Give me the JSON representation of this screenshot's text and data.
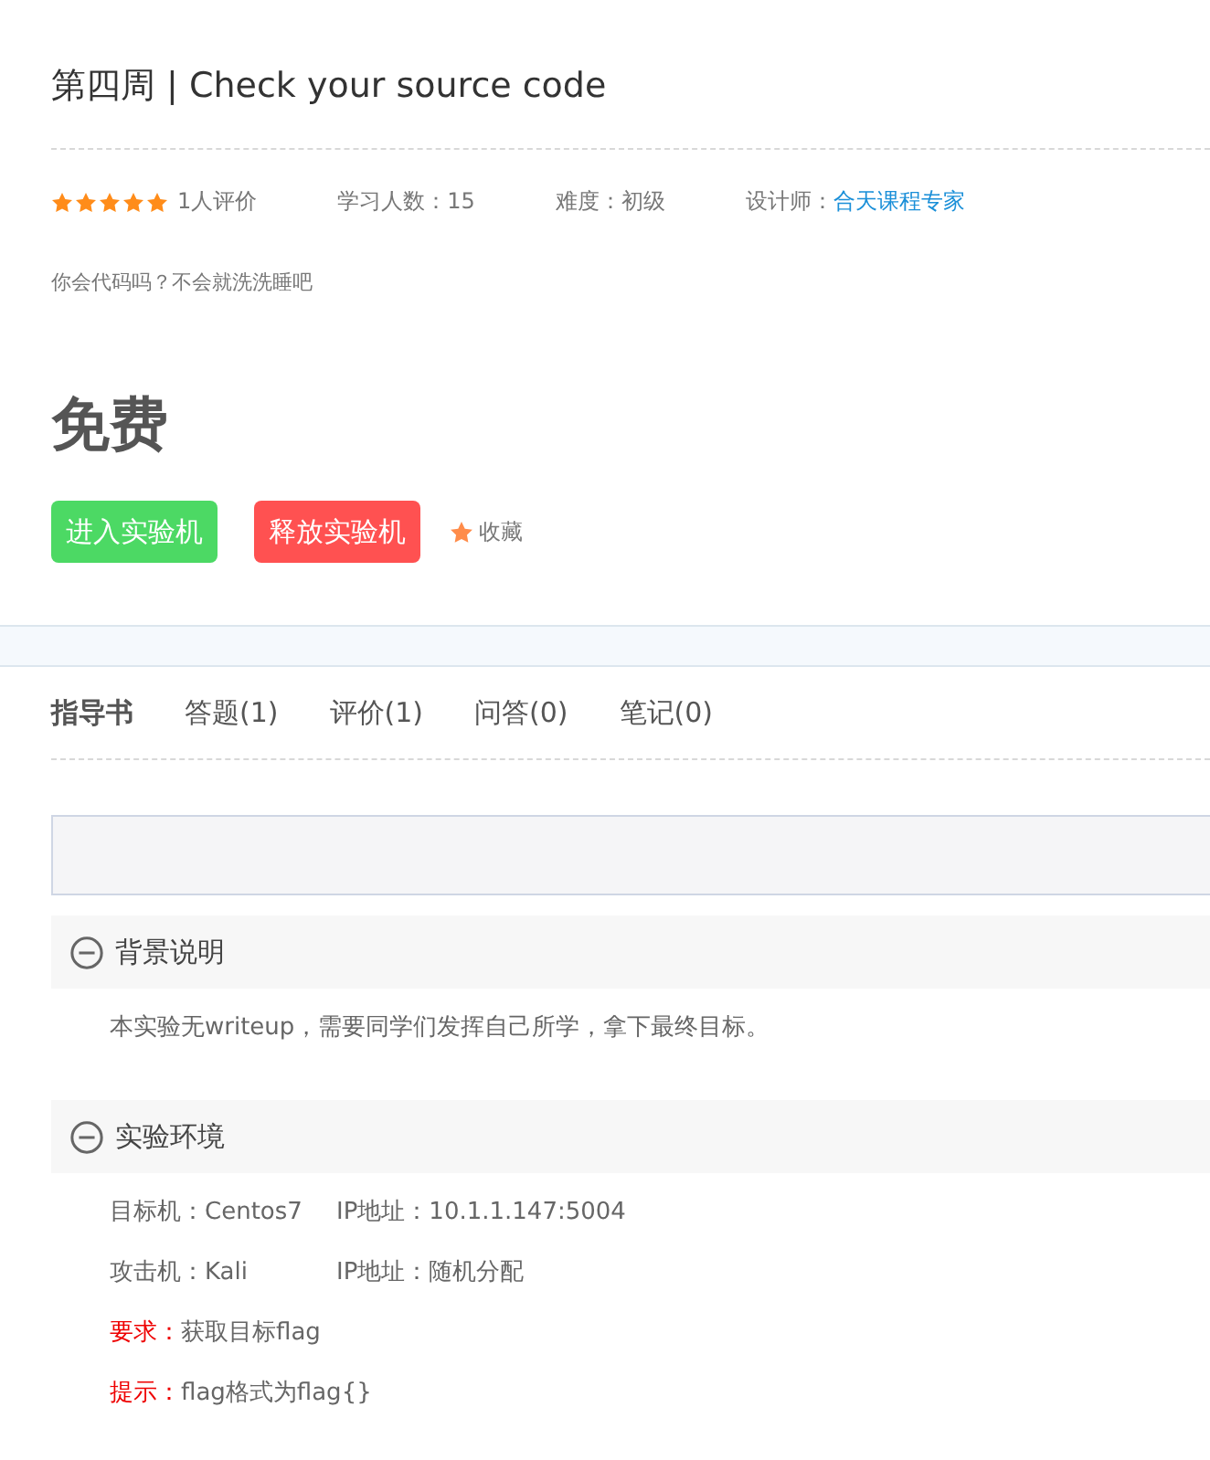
{
  "course": {
    "title": "第四周 | Check your source code",
    "stars": 5,
    "rating_count": "1人评价",
    "meta": [
      {
        "label": "学习人数：",
        "value": "15",
        "kind": "plain"
      },
      {
        "label": "难度：",
        "value": "初级",
        "kind": "plain"
      },
      {
        "label": "设计师：",
        "value": "合天课程专家",
        "kind": "link"
      }
    ],
    "description": "你会代码吗？不会就洗洗睡吧",
    "price": "免费"
  },
  "actions": [
    {
      "label": "进入实验机",
      "color": "#4cd964"
    },
    {
      "label": "释放实验机",
      "color": "#ff5151"
    }
  ],
  "favorite": {
    "label": "收藏"
  },
  "tabs": [
    {
      "label": "指导书",
      "selected": true
    },
    {
      "label": "答题(1)",
      "selected": false
    },
    {
      "label": "评价(1)",
      "selected": false
    },
    {
      "label": "问答(0)",
      "selected": false
    },
    {
      "label": "笔记(0)",
      "selected": false
    }
  ],
  "sections": [
    {
      "title": "背景说明",
      "expanded": true,
      "lines": [
        {
          "kind": "plain",
          "parts": [
            "本实验无writeup，需要同学们发挥自己所学，拿下最终目标。"
          ]
        }
      ]
    },
    {
      "title": "实验环境",
      "expanded": true,
      "lines": [
        {
          "kind": "plain",
          "parts": [
            "目标机：Centos7",
            "IP地址：10.1.1.147:5004"
          ]
        },
        {
          "kind": "plain",
          "parts": [
            "攻击机：Kali",
            "IP地址：随机分配"
          ]
        },
        {
          "kind": "note",
          "label": "要求：",
          "parts": [
            "获取目标flag"
          ]
        },
        {
          "kind": "note",
          "label": "提示：",
          "parts": [
            "flag格式为flag{}"
          ]
        }
      ]
    }
  ]
}
